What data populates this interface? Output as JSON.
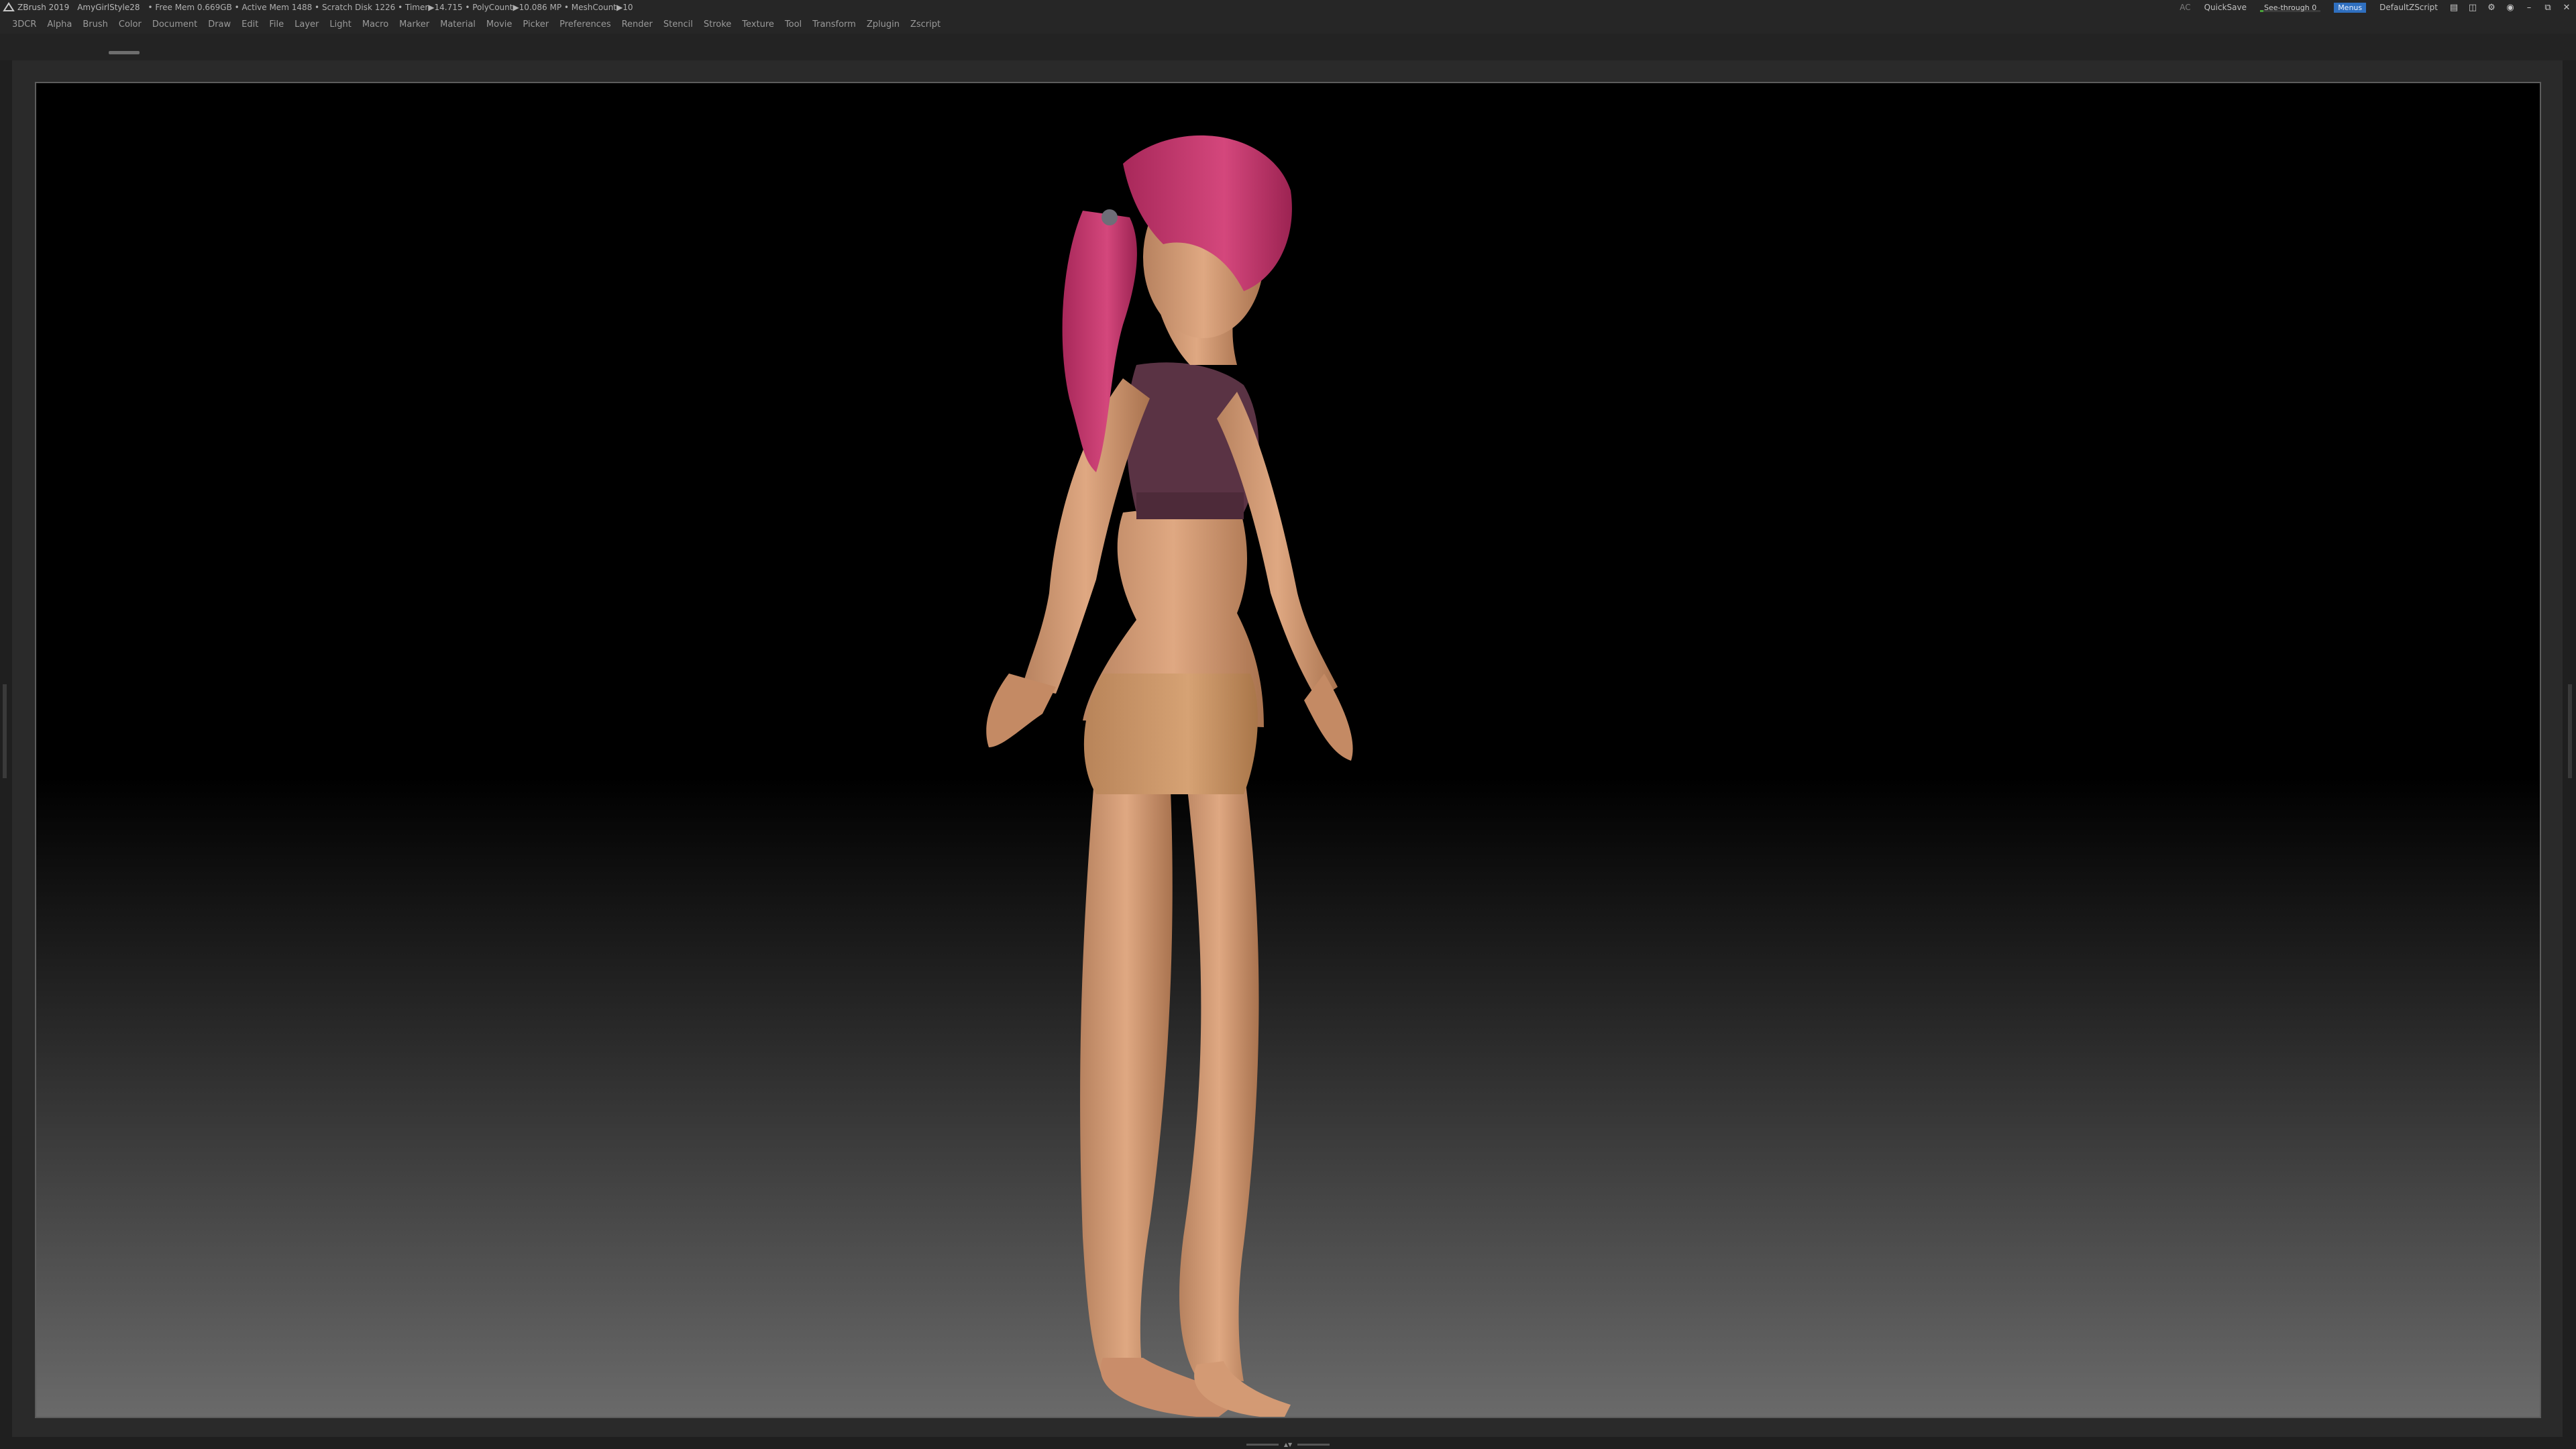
{
  "titlebar": {
    "app_name": "ZBrush 2019",
    "document": "AmyGirlStyle28",
    "status": "• Free Mem 0.669GB • Active Mem 1488 • Scratch Disk 1226 • Timer▶14.715 • PolyCount▶10.086 MP • MeshCount▶10",
    "ac_label": "AC",
    "quicksave_label": "QuickSave",
    "see_through_label": "See-through 0",
    "see_through_value": 0,
    "menus_label": "Menus",
    "script_label": "DefaultZScript"
  },
  "menubar": {
    "items": [
      "3DCR",
      "Alpha",
      "Brush",
      "Color",
      "Document",
      "Draw",
      "Edit",
      "File",
      "Layer",
      "Light",
      "Macro",
      "Marker",
      "Material",
      "Movie",
      "Picker",
      "Preferences",
      "Render",
      "Stencil",
      "Stroke",
      "Texture",
      "Tool",
      "Transform",
      "Zplugin",
      "Zscript"
    ]
  },
  "colors": {
    "accent": "#2f6fbf",
    "see_through_fill": "#4aa33a",
    "hair": "#c23b6a",
    "skin": "#d9a07a",
    "top": "#5a3344",
    "shorts": "#c49468"
  },
  "icons": {
    "app": "zbrush-icon",
    "window_controls": [
      "tray-icon",
      "layout-icon",
      "gear-icon",
      "lock-icon",
      "minimize-icon",
      "restore-icon",
      "close-icon"
    ]
  }
}
